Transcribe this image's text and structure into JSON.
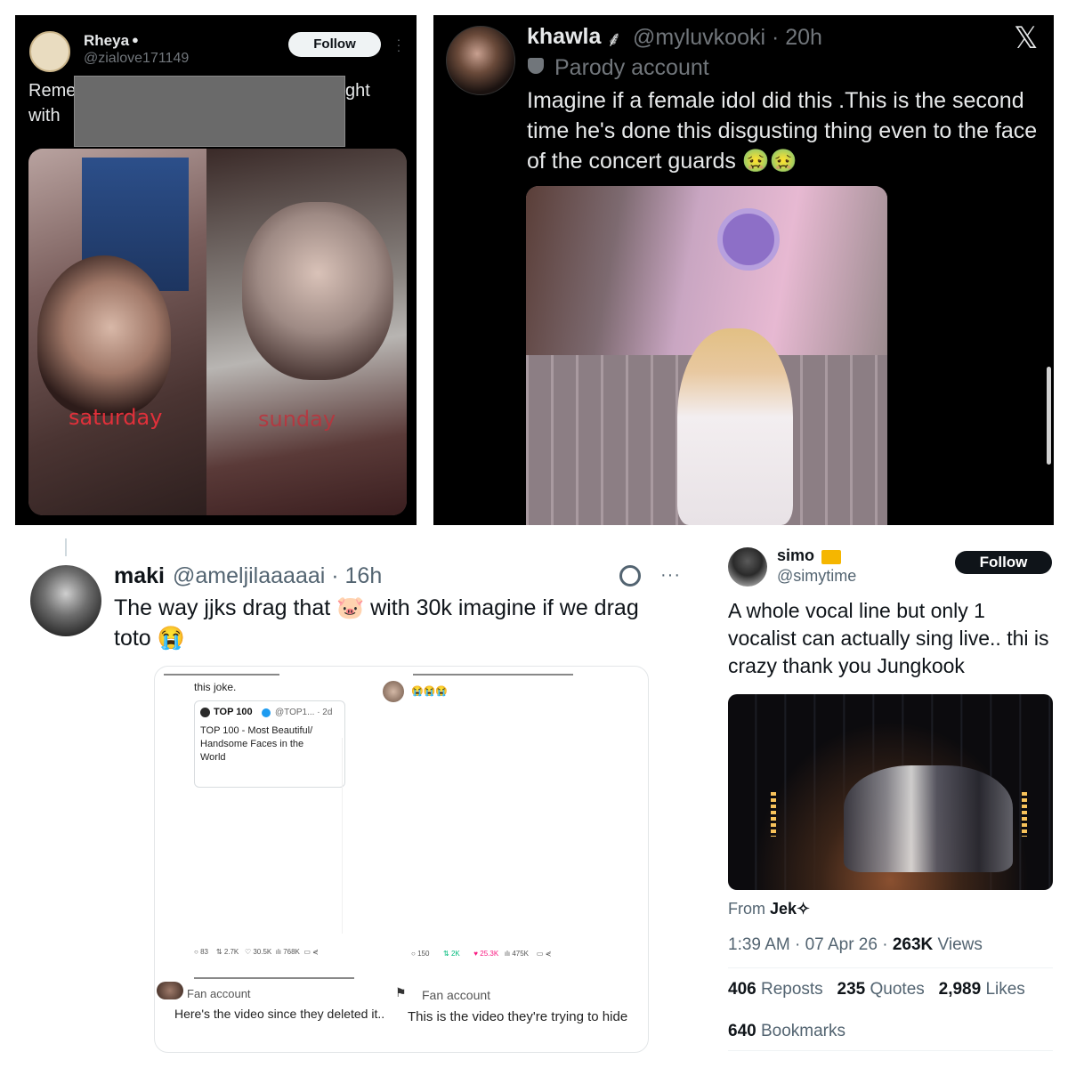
{
  "tweet1": {
    "name": "Rheya",
    "handle": "@zialove171149",
    "follow_label": "Follow",
    "text_line1_left": "Reme",
    "text_line1_right": "ght",
    "text_line2_left": "with",
    "photo_label_left": "saturday",
    "photo_label_right": "sunday"
  },
  "tweet2": {
    "name": "khawla",
    "handle_time": "@myluvkooki · 20h",
    "parody_label": "Parody account",
    "text": "Imagine if a female idol did this .This is the second time he's done this disgusting thing even to the face of the concert guards 🤢🤢"
  },
  "tweet3": {
    "name": "maki",
    "handle_time": "@ameljilaaaaai · 16h",
    "text": "The way jjks drag that 🐷 with 30k  imagine if we drag toto 😭",
    "embed": {
      "left_top_text": "this joke.",
      "quote_name": "TOP 100",
      "quote_handle": "@TOP1... · 2d",
      "quote_text": "TOP 100 - Most Beautiful/ Handsome Faces in the World",
      "right_top_emoji": "😭😭😭",
      "stats_left": [
        "83",
        "2.7K",
        "30.5K",
        "768K"
      ],
      "stats_right": [
        "150",
        "2K",
        "25.3K",
        "475K"
      ],
      "reply_left_badge": "Fan account",
      "reply_left_text": "Here's the video since they deleted it..",
      "reply_right_badge": "Fan account",
      "reply_right_text": "This is the video they're trying to hide"
    }
  },
  "tweet4": {
    "name": "simo",
    "handle": "@simytime",
    "follow_label": "Follow",
    "text": "A whole vocal line but only 1 vocalist can actually sing live.. thi is crazy thank you Jungkook",
    "from_label": "From",
    "from_name": "Jek✧",
    "time_date": "1:39 AM · 07 Apr 26 · ",
    "views_count": "263K",
    "views_label": " Views",
    "reposts_count": "406",
    "reposts_label": "Reposts",
    "quotes_count": "235",
    "quotes_label": "Quotes",
    "likes_count": "2,989",
    "likes_label": "Likes",
    "bookmarks_count": "640",
    "bookmarks_label": "Bookmarks"
  },
  "colors": {
    "x_dark_bg": "#000000",
    "x_text_light": "#e7e9ea",
    "x_text_grey": "#71767b",
    "x_text_dark": "#0f1419",
    "x_grey_light": "#536471",
    "photo_label_red": "#e0303a"
  }
}
